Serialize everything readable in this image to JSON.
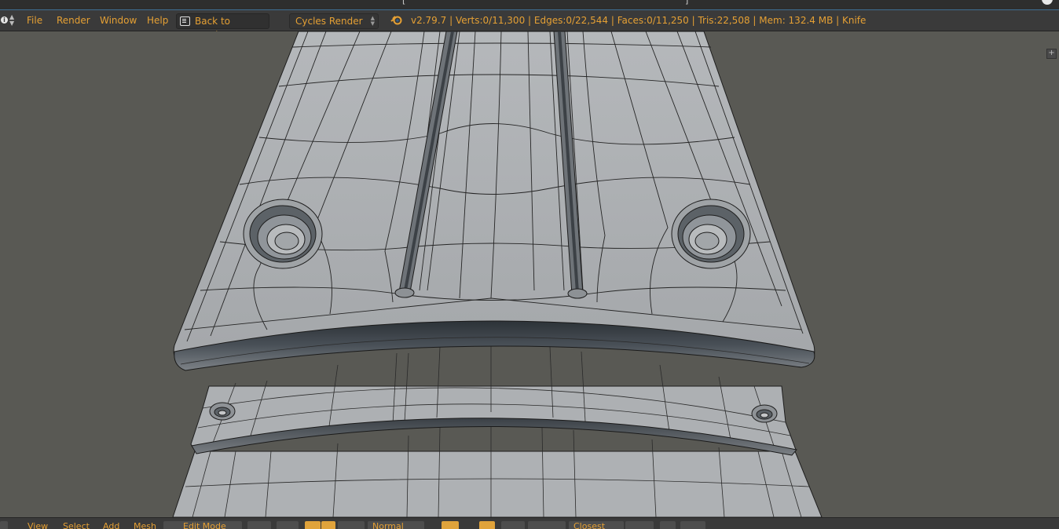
{
  "header": {
    "menu": [
      "File",
      "Render",
      "Window",
      "Help"
    ],
    "back_label": "Back to Previous",
    "render_engine": "Cycles Render",
    "stats": "v2.79.7 | Verts:0/11,300 | Edges:0/22,544 | Faces:0/11,250 | Tris:22,508 | Mem: 132.4 MB | Knife"
  },
  "footer": {
    "view": "View",
    "select": "Select",
    "add": "Add",
    "mesh": "Mesh",
    "mode": "Edit Mode",
    "orientation": "Normal",
    "snap_target": "Closest"
  },
  "colors": {
    "header_bg": "#3a3a3a",
    "accent_text": "#e5a034",
    "viewport_bg": "#595954",
    "mesh_face": "#a7a9ab",
    "mesh_edge": "#1f1f1f"
  },
  "icons": [
    "info-icon",
    "back-icon",
    "blender-logo-icon",
    "plus-icon",
    "sphere-icon",
    "vertex-select-icon",
    "edge-select-icon",
    "face-select-icon"
  ]
}
